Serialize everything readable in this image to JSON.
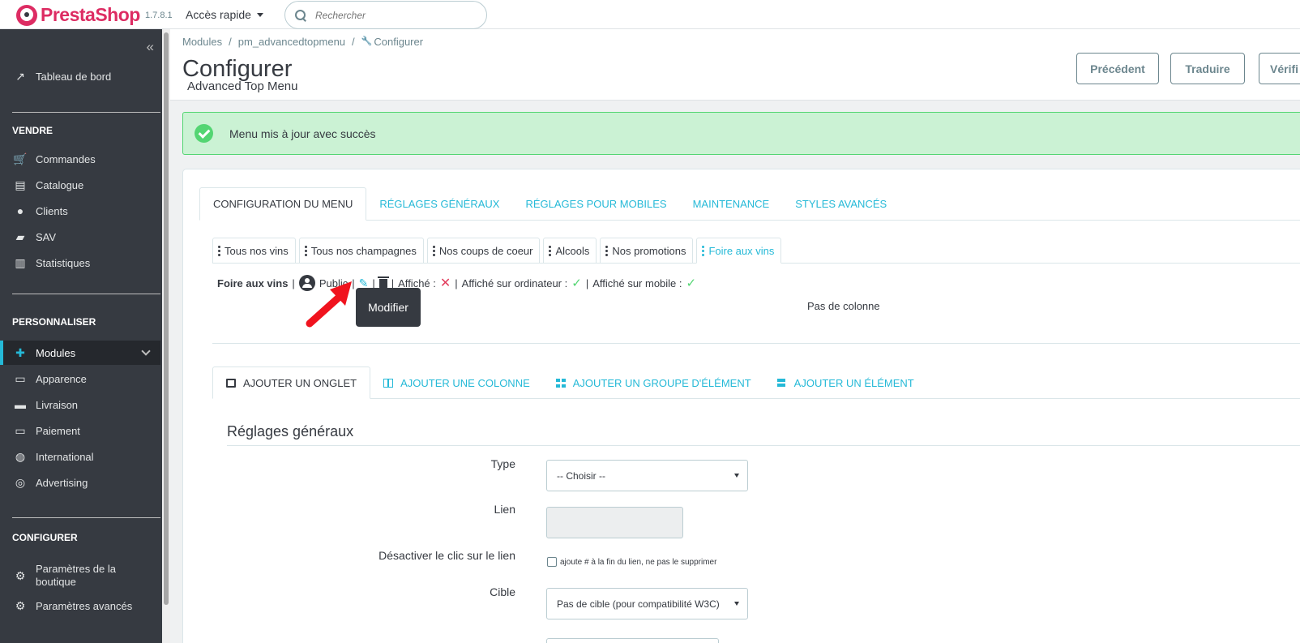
{
  "header": {
    "logo_text": "PrestaShop",
    "version": "1.7.8.1",
    "quick_access": "Accès rapide",
    "search_placeholder": "Rechercher"
  },
  "sidebar": {
    "dashboard": "Tableau de bord",
    "sections": [
      {
        "title": "VENDRE",
        "items": [
          "Commandes",
          "Catalogue",
          "Clients",
          "SAV",
          "Statistiques"
        ]
      },
      {
        "title": "PERSONNALISER",
        "items": [
          "Modules",
          "Apparence",
          "Livraison",
          "Paiement",
          "International",
          "Advertising"
        ]
      },
      {
        "title": "CONFIGURER",
        "items": [
          "Paramètres de la boutique",
          "Paramètres avancés"
        ]
      }
    ]
  },
  "breadcrumb": [
    "Modules",
    "pm_advancedtopmenu",
    "Configurer"
  ],
  "page": {
    "title": "Configurer",
    "subtitle": "Advanced Top Menu",
    "buttons": [
      "Précédent",
      "Traduire",
      "Vérifi"
    ]
  },
  "alert": {
    "text": "Menu mis à jour avec succès"
  },
  "tabs": [
    "CONFIGURATION DU MENU",
    "RÉGLAGES GÉNÉRAUX",
    "RÉGLAGES POUR MOBILES",
    "MAINTENANCE",
    "STYLES AVANCÉS"
  ],
  "menu_tabs": [
    "Tous nos vins",
    "Tous nos champagnes",
    "Nos coups de coeur",
    "Alcools",
    "Nos promotions",
    "Foire aux vins"
  ],
  "info": {
    "name": "Foire aux vins",
    "public": "Public",
    "displayed": "Affiché :",
    "displayed_desktop": "Affiché sur ordinateur :",
    "displayed_mobile": "Affiché sur mobile :",
    "sep": "|"
  },
  "tooltip": "Modifier",
  "no_column": "Pas de colonne",
  "sub_tabs": [
    "AJOUTER UN ONGLET",
    "AJOUTER UNE COLONNE",
    "AJOUTER UN GROUPE D'ÉLÉMENT",
    "AJOUTER UN ÉLÉMENT"
  ],
  "form": {
    "section_title": "Réglages généraux",
    "type_label": "Type",
    "type_value": "-- Choisir --",
    "link_label": "Lien",
    "disable_label": "Désactiver le clic sur le lien",
    "disable_hint": "ajoute # à la fin du lien, ne pas le supprimer",
    "target_label": "Cible",
    "target_value": "Pas de cible (pour compatibilité W3C)"
  },
  "colors": {
    "accent": "#25b9d7",
    "brand": "#dd2c63",
    "sidebar": "#363a41",
    "success": "#53d572",
    "danger": "#e23d5d"
  }
}
